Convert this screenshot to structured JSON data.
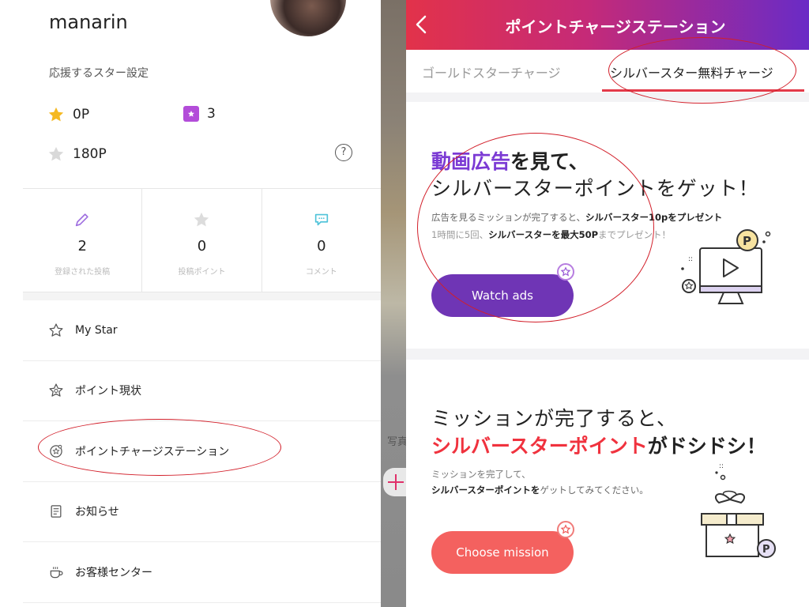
{
  "left": {
    "username": "manarin",
    "section_label": "応援するスター設定",
    "points": {
      "gold": "0P",
      "box_count": "3",
      "silver": "180P"
    },
    "help": "?",
    "stats": [
      {
        "icon": "pencil-icon",
        "value": "2",
        "label": "登録された投稿"
      },
      {
        "icon": "star-icon",
        "value": "0",
        "label": "投稿ポイント"
      },
      {
        "icon": "comment-icon",
        "value": "0",
        "label": "コメント"
      }
    ],
    "menu": [
      {
        "icon": "star-outline-icon",
        "label": "My Star"
      },
      {
        "icon": "point-star-icon",
        "label": "ポイント現状"
      },
      {
        "icon": "charge-station-icon",
        "label": "ポイントチャージステーション"
      },
      {
        "icon": "notice-icon",
        "label": "お知らせ"
      },
      {
        "icon": "coffee-cup-icon",
        "label": "お客様センター"
      }
    ]
  },
  "strip": {
    "text": "写真"
  },
  "right": {
    "header_title": "ポイントチャージステーション",
    "tabs": {
      "gold": "ゴールドスターチャージ",
      "silver": "シルバースター無料チャージ"
    },
    "ad_card": {
      "head_accent": "動画広告",
      "head_rest": "を見て、",
      "head_line2": "シルバースターポイントをゲット！",
      "line1_pre": "広告を見るミッションが完了すると、",
      "line1_bold": "シルバースター10pをプレゼント",
      "line2_pre": "1時間に5回、",
      "line2_bold": "シルバースターを最大50P",
      "line2_post": "までプレゼント！",
      "button": "Watch ads"
    },
    "mission_card": {
      "head_line1": "ミッションが完了すると、",
      "head_accent": "シルバースターポイント",
      "head_rest": "がドシドシ！",
      "line1": "ミッションを完了して、",
      "line2_bold": "シルバースターポイントを",
      "line2_rest": "ゲットしてみてください。",
      "button": "Choose mission"
    }
  },
  "colors": {
    "header_start": "#e2324a",
    "header_end": "#6a2bc6",
    "accent_purple": "#7b3ad4",
    "accent_red": "#f0323e",
    "watch_button": "#6f35b5",
    "mission_button": "#f4615f",
    "annotation_red": "#d21f2a"
  }
}
